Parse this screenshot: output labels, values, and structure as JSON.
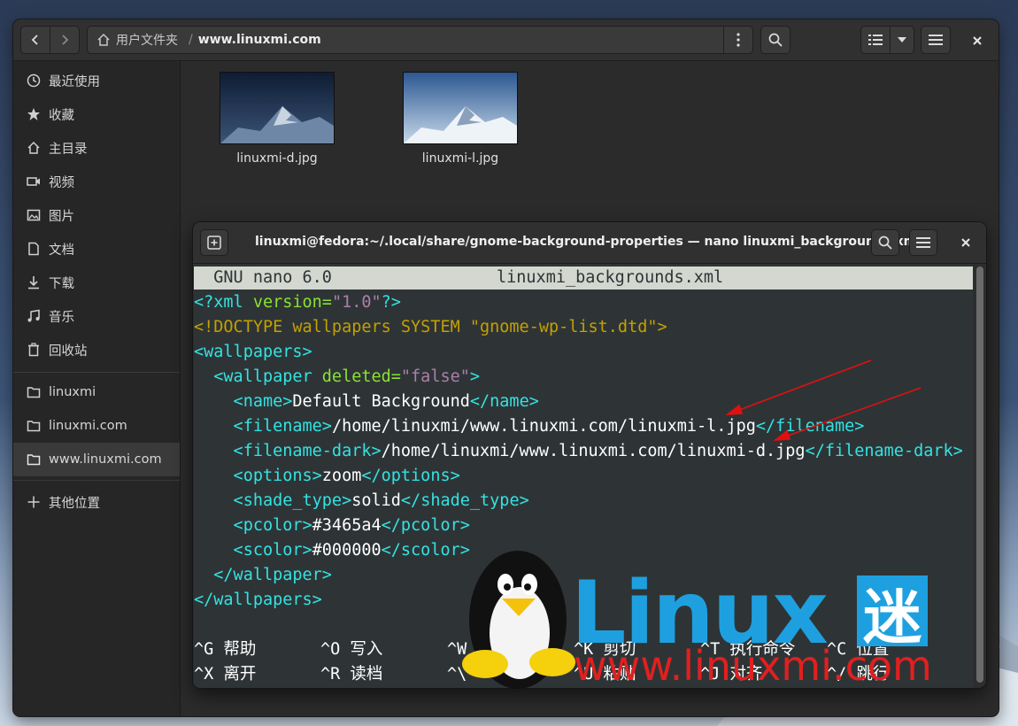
{
  "colors": {
    "accent": "#34e2e2",
    "attr": "#8ae234",
    "string": "#ad7fa8",
    "doctype": "#c4a000",
    "logo_blue": "#1ea0e0",
    "logo_red": "#e02020"
  },
  "file_manager": {
    "breadcrumb": {
      "home": "用户文件夹",
      "separator": "/",
      "current": "www.linuxmi.com"
    },
    "icons": {
      "back": "chevron-left-icon",
      "forward": "chevron-right-icon",
      "menu": "vertical-dots-icon",
      "search": "search-icon",
      "view": "list-view-icon",
      "sort": "chevron-down-icon",
      "hamburger": "hamburger-icon",
      "close": "close-icon"
    },
    "sidebar": [
      {
        "label": "最近使用",
        "icon": "clock-icon"
      },
      {
        "label": "收藏",
        "icon": "star-icon"
      },
      {
        "label": "主目录",
        "icon": "home-icon"
      },
      {
        "label": "视频",
        "icon": "video-icon"
      },
      {
        "label": "图片",
        "icon": "image-icon"
      },
      {
        "label": "文档",
        "icon": "document-icon"
      },
      {
        "label": "下载",
        "icon": "download-icon"
      },
      {
        "label": "音乐",
        "icon": "music-icon"
      },
      {
        "label": "回收站",
        "icon": "trash-icon"
      },
      {
        "label": "linuxmi",
        "icon": "folder-icon"
      },
      {
        "label": "linuxmi.com",
        "icon": "folder-icon"
      },
      {
        "label": "www.linuxmi.com",
        "icon": "folder-icon"
      },
      {
        "label": "其他位置",
        "icon": "plus-icon"
      }
    ],
    "files": [
      {
        "name": "linuxmi-d.jpg"
      },
      {
        "name": "linuxmi-l.jpg"
      }
    ]
  },
  "terminal": {
    "title": "linuxmi@fedora:~/.local/share/gnome-background-properties — nano linuxmi_backgrounds.xml",
    "nano_version": "  GNU nano 6.0",
    "filename": "linuxmi_backgrounds.xml",
    "xml": {
      "decl_open": "<?xml ",
      "decl_attr": "version=",
      "decl_val": "\"1.0\"",
      "decl_close": "?>",
      "doctype": "<!DOCTYPE wallpapers SYSTEM \"gnome-wp-list.dtd\">",
      "wallpapers_open": "<wallpapers>",
      "wallpaper_open": "  <wallpaper ",
      "deleted_attr": "deleted=",
      "deleted_val": "\"false\"",
      "wallpaper_open_end": ">",
      "name_open": "    <name>",
      "name_val": "Default Background",
      "name_close": "</name>",
      "filename_open": "    <filename>",
      "filename_val": "/home/linuxmi/www.linuxmi.com/linuxmi-l.jpg",
      "filename_close": "</filename>",
      "filename_dark_open": "    <filename-dark>",
      "filename_dark_val": "/home/linuxmi/www.linuxmi.com/linuxmi-d.jpg",
      "filename_dark_close": "</filename-dark>",
      "options_open": "    <options>",
      "options_val": "zoom",
      "options_close": "</options>",
      "shade_open": "    <shade_type>",
      "shade_val": "solid",
      "shade_close": "</shade_type>",
      "pcolor_open": "    <pcolor>",
      "pcolor_val": "#3465a4",
      "pcolor_close": "</pcolor>",
      "scolor_open": "    <scolor>",
      "scolor_val": "#000000",
      "scolor_close": "</scolor>",
      "wallpaper_close": "  </wallpaper>",
      "wallpapers_close": "</wallpapers>"
    },
    "shortcuts": [
      {
        "key": "^G",
        "label": "帮助"
      },
      {
        "key": "^O",
        "label": "写入"
      },
      {
        "key": "^W",
        "label": ""
      },
      {
        "key": "^K",
        "label": "剪切"
      },
      {
        "key": "^T",
        "label": "执行命令"
      },
      {
        "key": "^C",
        "label": "位置"
      },
      {
        "key": "^X",
        "label": "离开"
      },
      {
        "key": "^R",
        "label": "读档"
      },
      {
        "key": "^\\",
        "label": ""
      },
      {
        "key": "^U",
        "label": "粘贴"
      },
      {
        "key": "^J",
        "label": "对齐"
      },
      {
        "key": "^/",
        "label": "跳行"
      }
    ]
  },
  "watermark": {
    "brand": "Linux",
    "brand_suffix": "迷",
    "url": "www.linuxmi.com"
  }
}
